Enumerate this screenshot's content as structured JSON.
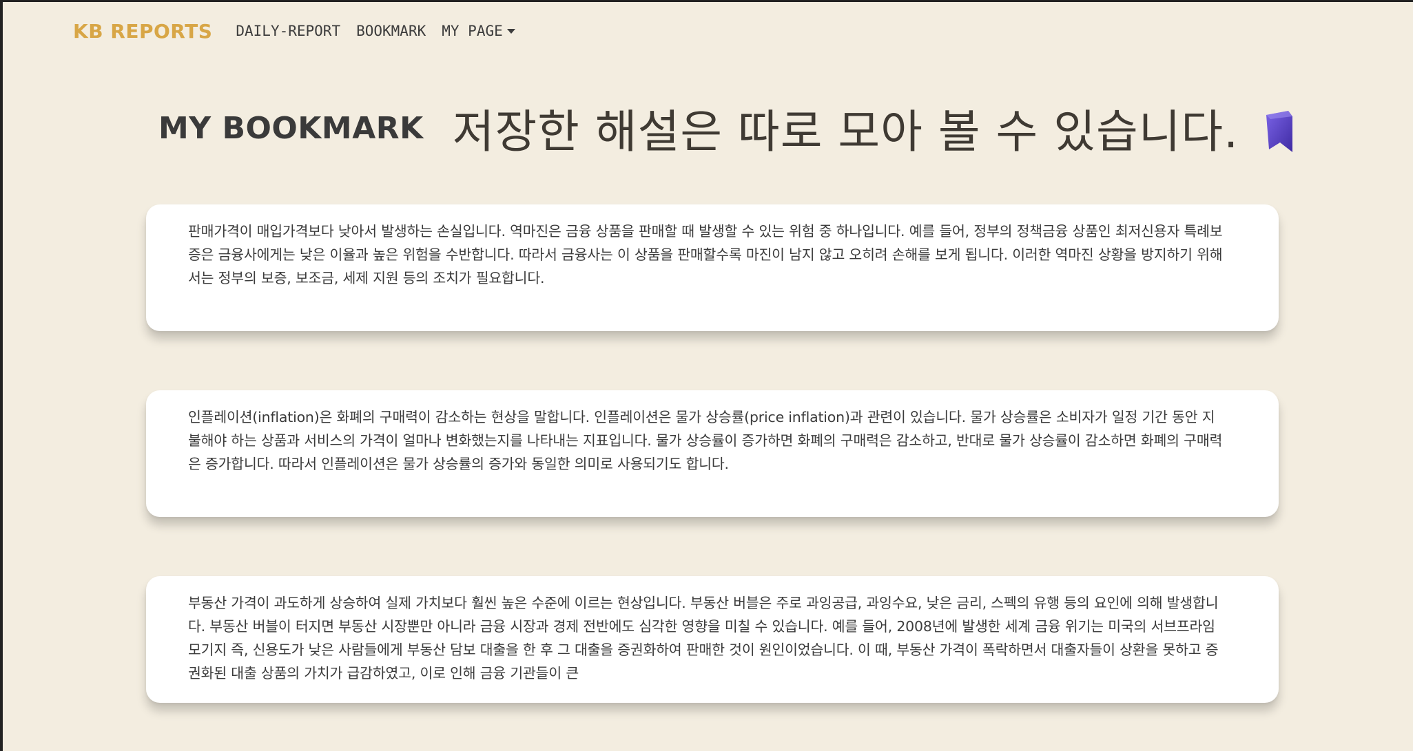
{
  "app": {
    "brand": "KB REPORTS"
  },
  "nav": {
    "items": [
      {
        "label": "DAILY-REPORT"
      },
      {
        "label": "BOOKMARK"
      },
      {
        "label": "MY PAGE"
      }
    ]
  },
  "page": {
    "title": "MY BOOKMARK",
    "subtitle": "저장한 해설은 따로 모아 볼 수 있습니다."
  },
  "colors": {
    "background": "#f3ede0",
    "brand": "#d8a646",
    "bookmark_icon": "#5b45c9"
  },
  "icons": {
    "bookmark": "bookmark-icon",
    "dropdown": "caret-down-icon"
  },
  "bookmarks": [
    {
      "text": "판매가격이 매입가격보다 낮아서 발생하는 손실입니다. 역마진은 금융 상품을 판매할 때 발생할 수 있는 위험 중 하나입니다. 예를 들어, 정부의 정책금융 상품인 최저신용자 특례보증은 금융사에게는 낮은 이율과 높은 위험을 수반합니다. 따라서 금융사는 이 상품을 판매할수록 마진이 남지 않고 오히려 손해를 보게 됩니다. 이러한 역마진 상황을 방지하기 위해서는 정부의 보증, 보조금, 세제 지원 등의 조치가 필요합니다."
    },
    {
      "text": "인플레이션(inflation)은 화폐의 구매력이 감소하는 현상을 말합니다. 인플레이션은 물가 상승률(price inflation)과 관련이 있습니다. 물가 상승률은 소비자가 일정 기간 동안 지불해야 하는 상품과 서비스의 가격이 얼마나 변화했는지를 나타내는 지표입니다. 물가 상승률이 증가하면 화폐의 구매력은 감소하고, 반대로 물가 상승률이 감소하면 화폐의 구매력은 증가합니다. 따라서 인플레이션은 물가 상승률의 증가와 동일한 의미로 사용되기도 합니다."
    },
    {
      "text": "부동산 가격이 과도하게 상승하여 실제 가치보다 훨씬 높은 수준에 이르는 현상입니다. 부동산 버블은 주로 과잉공급, 과잉수요, 낮은 금리, 스펙의 유행 등의 요인에 의해 발생합니다. 부동산 버블이 터지면 부동산 시장뿐만 아니라 금융 시장과 경제 전반에도 심각한 영향을 미칠 수 있습니다. 예를 들어, 2008년에 발생한 세계 금융 위기는 미국의 서브프라임 모기지 즉, 신용도가 낮은 사람들에게 부동산 담보 대출을 한 후 그 대출을 증권화하여 판매한 것이 원인이었습니다. 이 때, 부동산 가격이 폭락하면서 대출자들이 상환을 못하고 증권화된 대출 상품의 가치가 급감하였고, 이로 인해 금융 기관들이 큰"
    }
  ]
}
